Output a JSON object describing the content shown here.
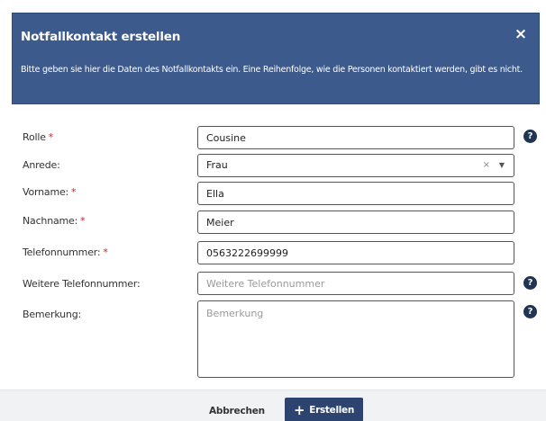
{
  "modal": {
    "title": "Notfallkontakt erstellen",
    "close_icon": "×",
    "description": "Bitte geben sie hier die Daten des Notfallkontakts ein. Eine Reihenfolge, wie die Personen kontaktiert werden, gibt es nicht."
  },
  "form": {
    "required_marker": "*",
    "help_icon": "?",
    "fields": {
      "rolle": {
        "label": "Rolle",
        "value": "Cousine"
      },
      "anrede": {
        "label": "Anrede:",
        "value": "Frau",
        "clear_icon": "×",
        "arrow_icon": "▼"
      },
      "vorname": {
        "label": "Vorname:",
        "value": "Ella"
      },
      "nachname": {
        "label": "Nachname:",
        "value": "Meier"
      },
      "telefon": {
        "label": "Telefonnummer:",
        "value": "0563222699999"
      },
      "weitere_telefon": {
        "label": "Weitere Telefonnummer:",
        "value": "",
        "placeholder": "Weitere Telefonnummer"
      },
      "bemerkung": {
        "label": "Bemerkung:",
        "value": "",
        "placeholder": "Bemerkung"
      }
    }
  },
  "footer": {
    "cancel_label": "Abbrechen",
    "create_label": "Erstellen",
    "create_icon": "+"
  },
  "colors": {
    "header_bg": "#3d5a8c",
    "primary_button": "#2e4470",
    "required": "#cc2222",
    "help_icon_bg": "#1f3553"
  }
}
